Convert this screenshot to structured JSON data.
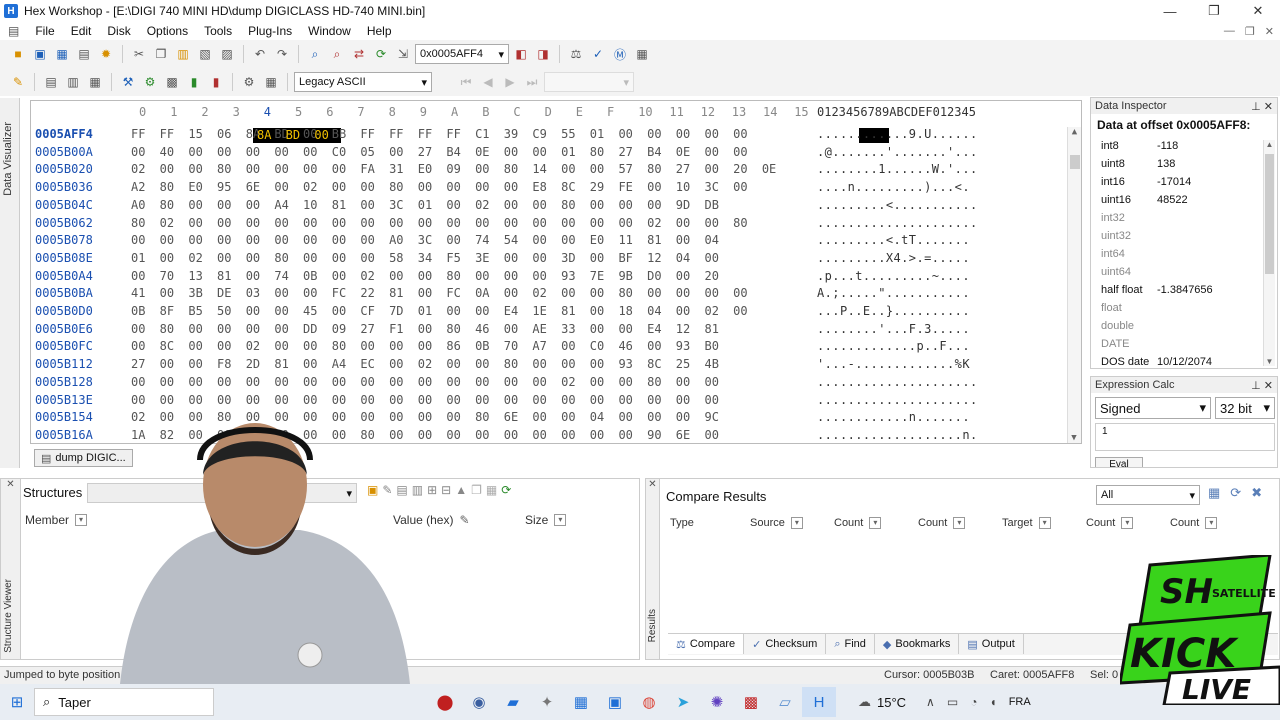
{
  "window": {
    "title": "Hex Workshop - [E:\\DIGI 740 MINI HD\\dump DIGICLASS HD-740 MINI.bin]",
    "app_icon": "H",
    "btn_min": "—",
    "btn_max": "❐",
    "btn_close": "✕"
  },
  "menu": [
    "File",
    "Edit",
    "Disk",
    "Options",
    "Tools",
    "Plug-Ins",
    "Window",
    "Help"
  ],
  "toolbar1": {
    "goto_value": "0x0005AFF4"
  },
  "toolbar2": {
    "encoding": "Legacy ASCII"
  },
  "sidebar_tab": "Data Visualizer",
  "hex": {
    "header_cols": [
      "0",
      "1",
      "2",
      "3",
      "4",
      "5",
      "6",
      "7",
      "8",
      "9",
      "A",
      "B",
      "C",
      "D",
      "E",
      "F",
      "10",
      "11",
      "12",
      "13",
      "14",
      "15"
    ],
    "ascii_header": "0123456789ABCDEF012345",
    "rows": [
      {
        "addr": "0005AFF4",
        "bytes": "FF FF 15 06 8A BD 00 BB FF FF FF FF C1 39 C9 55 01 00 00 00 00 00",
        "ascii": ". . . . . . . . . . . . 9 . U . . . . . ."
      },
      {
        "addr": "0005B00A",
        "bytes": "00 40 00 00 00 00 00 C0 05 00 27 B4 0E 00 00 01 80 27 B4 0E 00 00",
        "ascii": ". @ . . . . . . . ' . . . . . . . ' . . ."
      },
      {
        "addr": "0005B020",
        "bytes": "02 00 00 80 00 00 00 00 FA 31 E0 09 00 80 14 00 00 57 80 27 00 20 0E",
        "ascii": ". . . . . . . . 1 . . . . . . W . ' . . ."
      },
      {
        "addr": "0005B036",
        "bytes": "A2 80 E0 95 6E 00 02 00 00 80 00 00 00 00 E8 8C 29 FE 00 10 3C 00",
        "ascii": ". . . . n . . . . . . . . . ) . . . < ."
      },
      {
        "addr": "0005B04C",
        "bytes": "A0 80 00 00 00 A4 10 81 00 3C 01 00 02 00 00 80 00 00 00 9D DB",
        "ascii": ". . . . . . . . . < . . . . . . . . . . ."
      },
      {
        "addr": "0005B062",
        "bytes": "80 02 00 00 00 00 00 00 00 00 00 00 00 00 00 00 00 00 02 00 00 80",
        "ascii": ". . . . . . . . . . . . . . . . . . . . ."
      },
      {
        "addr": "0005B078",
        "bytes": "00 00 00 00 00 00 00 00 00 A0 3C 00 74 54 00 00 E0 11 81 00 04",
        "ascii": ". . . . . . . . . < . t T . . . . . . ."
      },
      {
        "addr": "0005B08E",
        "bytes": "01 00 02 00 00 80 00 00 00 58 34 F5 3E 00 00 3D 00 BF 12 04 00",
        "ascii": ". . . . . . . . . X 4 . > . = . . . . ."
      },
      {
        "addr": "0005B0A4",
        "bytes": "00 70 13 81 00 74 0B 00 02 00 00 80 00 00 00 93 7E 9B D0 00 20",
        "ascii": ". p . . . t . . . . . . . . . ~ . . . ."
      },
      {
        "addr": "0005B0BA",
        "bytes": "41 00 3B DE 03 00 00 FC 22 81 00 FC 0A 00 02 00 00 80 00 00 00 00",
        "ascii": "A . ; . . . . . \" . . . . . . . . . . ."
      },
      {
        "addr": "0005B0D0",
        "bytes": "0B 8F B5 50 00 00 45 00 CF 7D 01 00 00 E4 1E 81 00 18 04 00 02 00",
        "ascii": ". . . P . . E . . } . . . . . . . . . ."
      },
      {
        "addr": "0005B0E6",
        "bytes": "00 80 00 00 00 00 DD 09 27 F1 00 80 46 00 AE 33 00 00 E4 12 81",
        "ascii": ". . . . . . . . ' . . . F . 3 . . . . ."
      },
      {
        "addr": "0005B0FC",
        "bytes": "00 8C 00 00 02 00 00 80 00 00 00 86 0B 70 A7 00 C0 46 00 93 B0",
        "ascii": ". . . . . . . . . . . . . p . . F . . ."
      },
      {
        "addr": "0005B112",
        "bytes": "27 00 00 F8 2D 81 00 A4 EC 00 02 00 00 80 00 00 00 93 8C 25 4B",
        "ascii": "' . . . - . . . . . . . . . . . . . % K"
      },
      {
        "addr": "0005B128",
        "bytes": "00 00 00 00 00 00 00 00 00 00 00 00 00 00 00 02 00 00 80 00 00",
        "ascii": ". . . . . . . . . . . . . . . . . . . . ."
      },
      {
        "addr": "0005B13E",
        "bytes": "00 00 00 00 00 00 00 00 00 00 00 00 00 00 00 00 00 00 00 00 00",
        "ascii": ". . . . . . . . . . . . . . . . . . . . ."
      },
      {
        "addr": "0005B154",
        "bytes": "02 00 00 80 00 00 00 00 00 00 00 00 80 6E 00 00 04 00 00 00 9C",
        "ascii": ". . . . . . . . . . . . n . . . . . . ."
      },
      {
        "addr": "0005B16A",
        "bytes": "1A 82 00 00 00 00 00 00 80 00 00 00 00 00 00 00 00 00 90 6E 00",
        "ascii": ". . . . . . . . . . . . . . . . . . . n ."
      }
    ],
    "selection": "8A BD 00"
  },
  "doc_tab": "dump DIGIC...",
  "data_inspector": {
    "panel_title": "Data Inspector",
    "heading": "Data at offset 0x0005AFF8:",
    "rows": [
      {
        "k": "int8",
        "v": "-118"
      },
      {
        "k": "uint8",
        "v": "138"
      },
      {
        "k": "int16",
        "v": "-17014"
      },
      {
        "k": "uint16",
        "v": "48522"
      },
      {
        "k": "int32",
        "v": ""
      },
      {
        "k": "uint32",
        "v": ""
      },
      {
        "k": "int64",
        "v": ""
      },
      {
        "k": "uint64",
        "v": ""
      },
      {
        "k": "half float",
        "v": "-1.3847656"
      },
      {
        "k": "float",
        "v": ""
      },
      {
        "k": "double",
        "v": ""
      },
      {
        "k": "DATE",
        "v": ""
      },
      {
        "k": "DOS date",
        "v": "10/12/2074"
      }
    ]
  },
  "expression_calc": {
    "panel_title": "Expression Calc",
    "sign": "Signed",
    "bits": "32 bit",
    "expression": "1",
    "eval": "Eval"
  },
  "structures": {
    "title": "Structures",
    "side_tab": "Structure Viewer",
    "cols": {
      "member": "Member",
      "value": "Value (hex)",
      "size": "Size"
    }
  },
  "compare": {
    "title": "Compare Results",
    "filter": "All",
    "side_tab": "Results",
    "cols": [
      "Type",
      "Source",
      "Count",
      "Count",
      "Target",
      "Count",
      "Count"
    ],
    "tabs": [
      "Compare",
      "Checksum",
      "Find",
      "Bookmarks",
      "Output"
    ]
  },
  "status": {
    "message": "Jumped to byte position",
    "cursor": "Cursor: 0005B03B",
    "caret": "Caret: 0005AFF8",
    "sel": "Sel: 0"
  },
  "taskbar": {
    "search": "Taper",
    "temp": "15°C",
    "lang": "FRA"
  },
  "overlay": {
    "brand_top": "SH",
    "brand_sub": "SATELLITE",
    "kick": "KICK",
    "live": "LIVE"
  },
  "colors": {
    "accent": "#1a4fb0",
    "selection": "#000000",
    "kick_green": "#39d31b"
  }
}
